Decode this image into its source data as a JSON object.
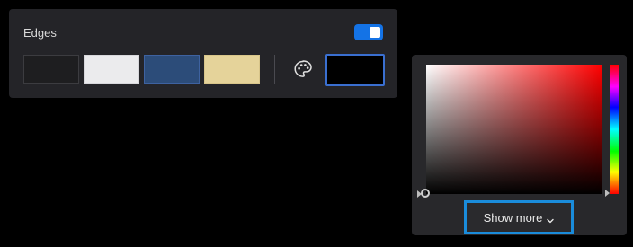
{
  "edges_panel": {
    "title": "Edges",
    "toggle_on": true,
    "swatches": [
      {
        "name": "dark",
        "color": "#1e1e20"
      },
      {
        "name": "light-gray",
        "color": "#ebebed"
      },
      {
        "name": "blue",
        "color": "#2c4c79"
      },
      {
        "name": "sand",
        "color": "#e5d39a"
      }
    ],
    "palette_icon": "palette-icon",
    "selected_color": "#000000"
  },
  "color_picker": {
    "hue_color": "#ff0000",
    "show_more_label": "Show more",
    "show_more_icon": "chevron-down-icon"
  },
  "colors": {
    "accent": "#1473e6",
    "focus_ring": "#1a8cdb"
  }
}
